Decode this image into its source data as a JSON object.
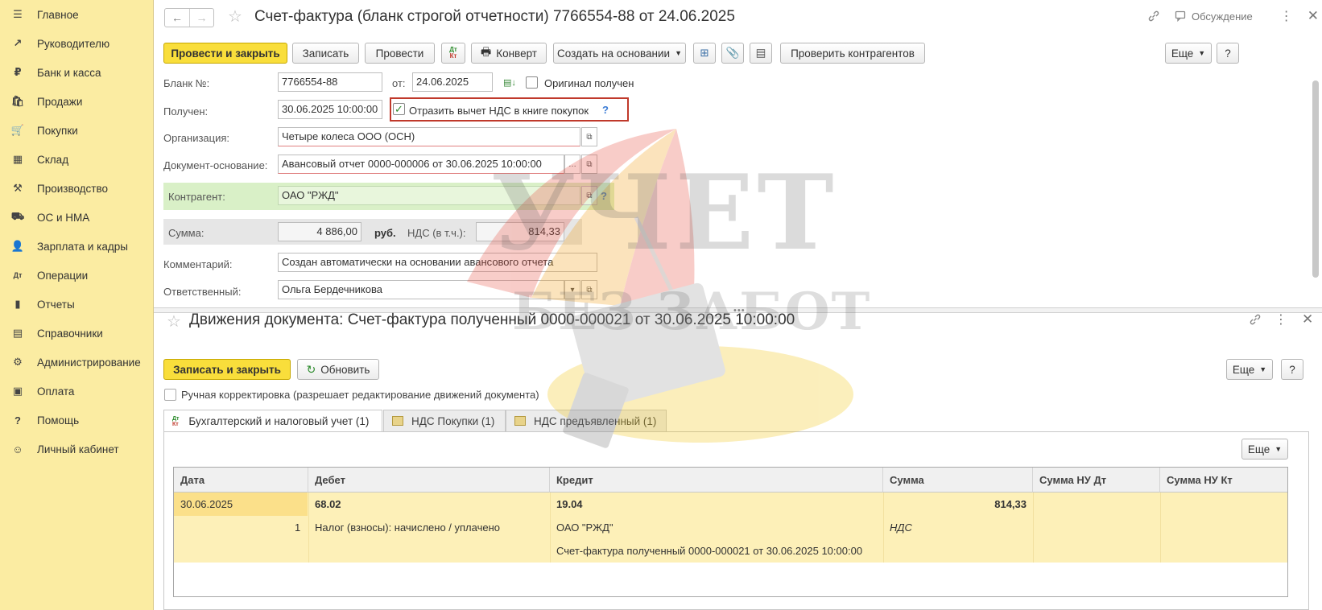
{
  "sidebar": {
    "items": [
      {
        "label": "Главное",
        "icon": "☰",
        "icon_name": "menu-icon"
      },
      {
        "label": "Руководителю",
        "icon": "↗",
        "icon_name": "trend-icon"
      },
      {
        "label": "Банк и касса",
        "icon": "₽",
        "icon_name": "ruble-icon"
      },
      {
        "label": "Продажи",
        "icon": "🛍",
        "icon_name": "bag-icon"
      },
      {
        "label": "Покупки",
        "icon": "🛒",
        "icon_name": "cart-icon"
      },
      {
        "label": "Склад",
        "icon": "▦",
        "icon_name": "warehouse-icon"
      },
      {
        "label": "Производство",
        "icon": "⚒",
        "icon_name": "factory-icon"
      },
      {
        "label": "ОС и НМА",
        "icon": "⛟",
        "icon_name": "truck-icon"
      },
      {
        "label": "Зарплата и кадры",
        "icon": "👤",
        "icon_name": "person-icon"
      },
      {
        "label": "Операции",
        "icon": "Дт",
        "icon_name": "dt-kt-icon"
      },
      {
        "label": "Отчеты",
        "icon": "▮",
        "icon_name": "bar-chart-icon"
      },
      {
        "label": "Справочники",
        "icon": "▤",
        "icon_name": "book-icon"
      },
      {
        "label": "Администрирование",
        "icon": "⚙",
        "icon_name": "gear-icon"
      },
      {
        "label": "Оплата",
        "icon": "▣",
        "icon_name": "payment-icon"
      },
      {
        "label": "Помощь",
        "icon": "?",
        "icon_name": "help-icon"
      },
      {
        "label": "Личный кабинет",
        "icon": "☺",
        "icon_name": "account-icon"
      }
    ]
  },
  "top_panel": {
    "title": "Счет-фактура (бланк строгой отчетности) 7766554-88 от 24.06.2025",
    "discussion_label": "Обсуждение",
    "toolbar": {
      "post_close": "Провести и закрыть",
      "save": "Записать",
      "post": "Провести",
      "dtkt": "Дт Кт",
      "envelope": "Конверт",
      "create_based": "Создать на основании",
      "check_counterparties": "Проверить контрагентов",
      "more": "Еще",
      "help": "?"
    },
    "form": {
      "blank_label": "Бланк №:",
      "blank_value": "7766554-88",
      "from_label": "от:",
      "from_value": "24.06.2025",
      "original_label": "Оригинал получен",
      "received_label": "Получен:",
      "received_value": "30.06.2025 10:00:00",
      "vat_deduct_label": "Отразить вычет НДС в книге покупок",
      "organization_label": "Организация:",
      "organization_value": "Четыре колеса ООО (ОСН)",
      "basis_label": "Документ-основание:",
      "basis_value": "Авансовый отчет 0000-000006 от 30.06.2025 10:00:00",
      "counterparty_label": "Контрагент:",
      "counterparty_value": "ОАО \"РЖД\"",
      "sum_label": "Сумма:",
      "sum_value": "4 886,00",
      "currency": "руб.",
      "vat_label": "НДС (в т.ч.):",
      "vat_value": "814,33",
      "comment_label": "Комментарий:",
      "comment_value": "Создан автоматически на основании авансового отчета",
      "responsible_label": "Ответственный:",
      "responsible_value": "Ольга Бердечникова"
    }
  },
  "bottom_panel": {
    "title": "Движения документа: Счет-фактура полученный 0000-000021 от 30.06.2025 10:00:00",
    "toolbar": {
      "save_close": "Записать и закрыть",
      "refresh": "Обновить",
      "more": "Еще",
      "help": "?"
    },
    "manual_label": "Ручная корректировка (разрешает редактирование движений документа)",
    "tabs": [
      {
        "label": "Бухгалтерский и налоговый учет (1)"
      },
      {
        "label": "НДС Покупки (1)"
      },
      {
        "label": "НДС предъявленный (1)"
      }
    ],
    "inner_more": "Еще",
    "table": {
      "columns": [
        "Дата",
        "Дебет",
        "Кредит",
        "Сумма",
        "Сумма НУ Дт",
        "Сумма НУ Кт"
      ],
      "row": {
        "date": "30.06.2025",
        "line_no": "1",
        "debit_account": "68.02",
        "debit_subconto": "Налог (взносы): начислено / уплачено",
        "credit_account": "19.04",
        "credit_sub1": "ОАО \"РЖД\"",
        "credit_sub2": "Счет-фактура полученный 0000-000021 от 30.06.2025 10:00:00",
        "amount": "814,33",
        "amount_note": "НДС"
      }
    }
  },
  "watermark": {
    "line1": "УЧЕТ",
    "line2": "БЕЗ ЗАБОТ"
  },
  "colors": {
    "sidebar_bg": "#fbeca2",
    "primary_button": "#f9de3b",
    "highlight_border": "#c0392b",
    "row_highlight": "#fdf0b8"
  }
}
